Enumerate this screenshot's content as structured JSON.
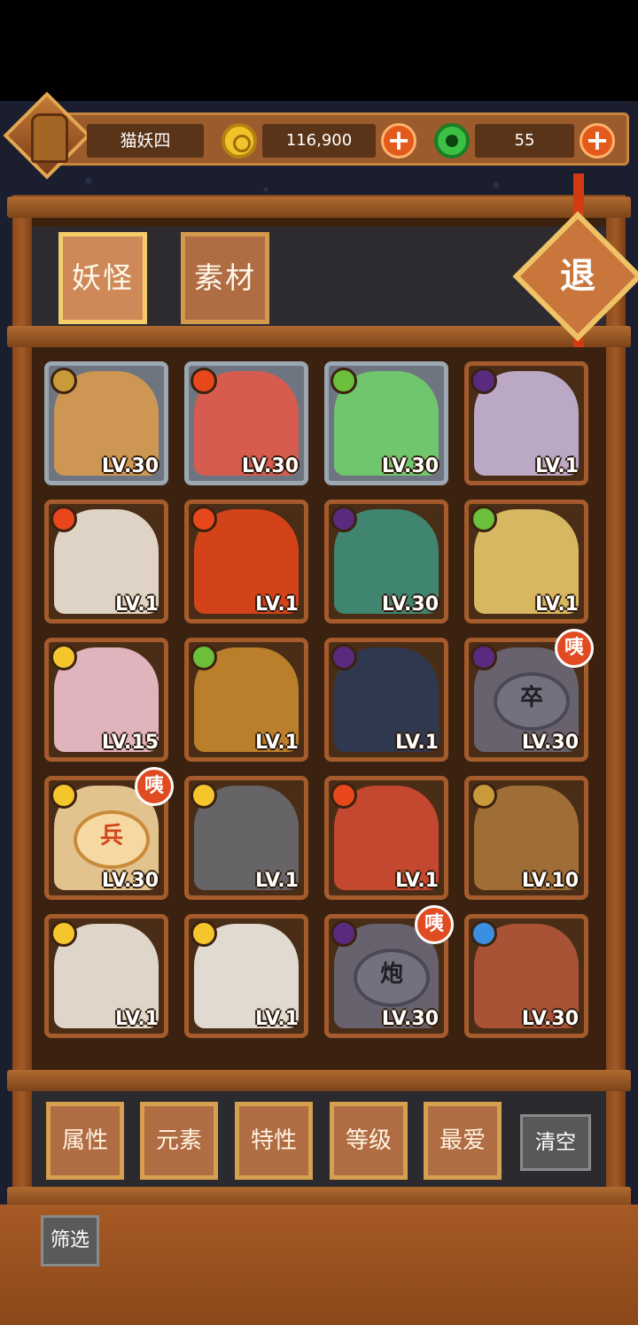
{
  "player": {
    "name": "猫妖四"
  },
  "currency": {
    "gold": "116,900",
    "jade": "55",
    "add_symbol": "+"
  },
  "tabs": [
    {
      "label": "妖怪",
      "active": true
    },
    {
      "label": "素材",
      "active": false
    }
  ],
  "exit_label": "退",
  "cards": [
    {
      "level": "LV.30",
      "element": "earth",
      "frame": "silver",
      "subject": "earth-fairy"
    },
    {
      "level": "LV.30",
      "element": "fire",
      "frame": "silver",
      "subject": "fire-fairy"
    },
    {
      "level": "LV.30",
      "element": "wood",
      "frame": "silver",
      "subject": "wood-fairy"
    },
    {
      "level": "LV.1",
      "element": "dark",
      "frame": "wood",
      "subject": "pig"
    },
    {
      "level": "LV.1",
      "element": "fire",
      "frame": "wood",
      "subject": "horse"
    },
    {
      "level": "LV.1",
      "element": "fire",
      "frame": "wood",
      "subject": "phoenix"
    },
    {
      "level": "LV.30",
      "element": "dark",
      "frame": "wood",
      "subject": "green-hair-girl"
    },
    {
      "level": "LV.1",
      "element": "wood",
      "frame": "wood",
      "subject": "blonde-girl"
    },
    {
      "level": "LV.15",
      "element": "light",
      "frame": "wood",
      "subject": "rabbit-hood"
    },
    {
      "level": "LV.1",
      "element": "wood",
      "frame": "wood",
      "subject": "monkey-king"
    },
    {
      "level": "LV.1",
      "element": "dark",
      "frame": "wood",
      "subject": "wolf-warrior"
    },
    {
      "level": "LV.30",
      "element": "dark",
      "frame": "wood",
      "subject": "chess-zu",
      "piece": "卒",
      "badge": "咦"
    },
    {
      "level": "LV.30",
      "element": "light",
      "frame": "wood",
      "subject": "chess-bing",
      "piece": "兵",
      "badge": "咦"
    },
    {
      "level": "LV.1",
      "element": "light",
      "frame": "wood",
      "subject": "seal"
    },
    {
      "level": "LV.1",
      "element": "fire",
      "frame": "wood",
      "subject": "red-hair-cat"
    },
    {
      "level": "LV.10",
      "element": "earth",
      "frame": "wood",
      "subject": "snail-kid"
    },
    {
      "level": "LV.1",
      "element": "light",
      "frame": "wood",
      "subject": "old-sage"
    },
    {
      "level": "LV.1",
      "element": "light",
      "frame": "wood",
      "subject": "white-dog"
    },
    {
      "level": "LV.30",
      "element": "dark",
      "frame": "wood",
      "subject": "chess-pao",
      "piece": "炮",
      "badge": "咦"
    },
    {
      "level": "LV.30",
      "element": "water",
      "frame": "wood",
      "subject": "sausage"
    }
  ],
  "filters": [
    {
      "label": "属性"
    },
    {
      "label": "元素"
    },
    {
      "label": "特性"
    },
    {
      "label": "等级"
    },
    {
      "label": "最爱"
    }
  ],
  "clear_label": "清空",
  "screen_label": "筛选",
  "colors": {
    "fire": "#e8461b",
    "wood": "#6bbf3a",
    "dark": "#5a2a7e",
    "light": "#f5c52c",
    "earth": "#c99a3a",
    "water": "#3a8fe0"
  }
}
